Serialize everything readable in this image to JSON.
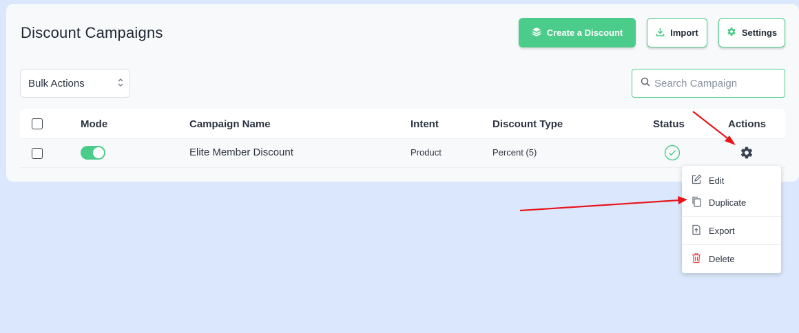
{
  "header": {
    "title": "Discount Campaigns",
    "create_label": "Create a Discount",
    "import_label": "Import",
    "settings_label": "Settings"
  },
  "toolbar": {
    "bulk_actions": "Bulk Actions",
    "search_placeholder": "Search Campaign"
  },
  "table": {
    "columns": [
      "Mode",
      "Campaign Name",
      "Intent",
      "Discount Type",
      "Status",
      "Actions"
    ],
    "rows": [
      {
        "mode_enabled": true,
        "name": "Elite Member Discount",
        "intent": "Product",
        "discount_type": "Percent (5)",
        "status": "active"
      }
    ]
  },
  "actions_menu": {
    "items": [
      "Edit",
      "Duplicate",
      "Export",
      "Delete"
    ]
  },
  "colors": {
    "accent": "#4ccc8a",
    "background": "#dbe7fc",
    "delete": "#e04848",
    "annotation_arrow": "#e8141a"
  },
  "icons": {
    "create": "layers-icon",
    "import": "download-icon",
    "settings": "gear-icon",
    "search": "search-icon",
    "status": "check-circle-icon",
    "row_action": "gear-icon",
    "edit": "edit-icon",
    "duplicate": "copy-icon",
    "export": "export-icon",
    "delete": "trash-icon"
  }
}
